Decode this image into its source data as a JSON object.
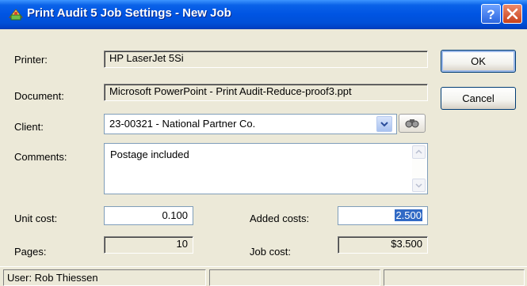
{
  "window": {
    "title": "Print Audit 5 Job Settings - New Job"
  },
  "titlebar": {
    "help_label": "?",
    "close_label": "✕"
  },
  "labels": {
    "printer": "Printer:",
    "document": "Document:",
    "client": "Client:",
    "comments": "Comments:",
    "unit_cost": "Unit cost:",
    "added_costs": "Added costs:",
    "pages": "Pages:",
    "job_cost": "Job cost:"
  },
  "values": {
    "printer": "HP LaserJet 5Si",
    "document": "Microsoft PowerPoint - Print Audit-Reduce-proof3.ppt",
    "client": "23-00321 - National Partner Co.",
    "comments": "Postage included",
    "unit_cost": "0.100",
    "added_costs": "2.500",
    "pages": "10",
    "job_cost": "$3.500"
  },
  "buttons": {
    "ok": "OK",
    "cancel": "Cancel"
  },
  "status": {
    "user": "User: Rob Thiessen",
    "panel2": "",
    "panel3": ""
  },
  "icons": {
    "app": "print-audit-icon",
    "help": "help-icon",
    "close": "close-icon",
    "dropdown": "chevron-down-icon",
    "find": "binoculars-icon",
    "scroll_up": "arrow-up-icon",
    "scroll_down": "arrow-down-icon"
  },
  "colors": {
    "titlebar": "#0054e3",
    "selection": "#316ac5",
    "dialog_bg": "#ece9d8"
  }
}
